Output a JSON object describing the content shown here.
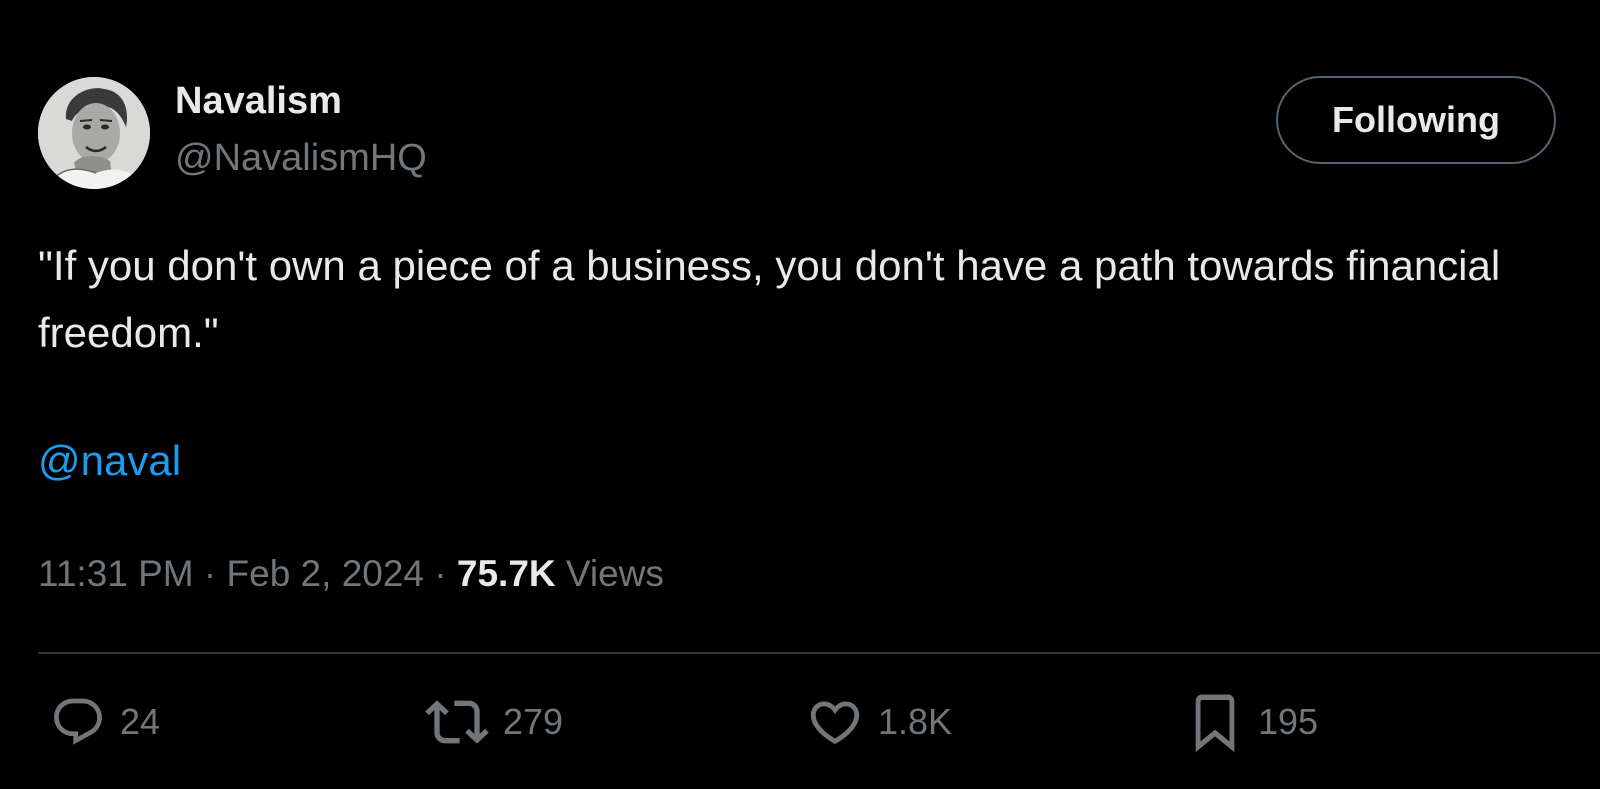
{
  "author": {
    "display_name": "Navalism",
    "handle": "@NavalismHQ",
    "avatar_icon": "avatar-portrait"
  },
  "follow_button": {
    "label": "Following"
  },
  "tweet": {
    "text": "\"If you don't own a piece of a business, you don't have a path towards financial freedom.\"",
    "mention": "@naval"
  },
  "meta": {
    "time": "11:31 PM",
    "separator": " · ",
    "date": "Feb 2, 2024",
    "views_count": "75.7K",
    "views_label": " Views"
  },
  "actions": {
    "reply": {
      "icon": "reply-icon",
      "count": "24"
    },
    "retweet": {
      "icon": "retweet-icon",
      "count": "279"
    },
    "like": {
      "icon": "heart-icon",
      "count": "1.8K"
    },
    "bookmark": {
      "icon": "bookmark-icon",
      "count": "195"
    }
  },
  "colors": {
    "background": "#000000",
    "primary_text": "#e7e9ea",
    "secondary_text": "#71767b",
    "link": "#1d9bf0",
    "divider": "#2f3336"
  }
}
